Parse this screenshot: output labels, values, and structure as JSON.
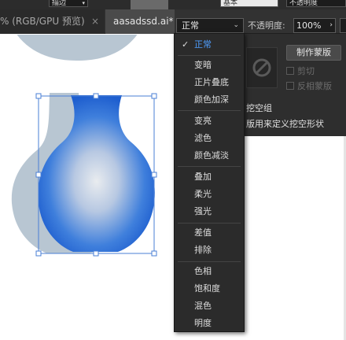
{
  "top_bar": {
    "chip_left_label": "描边",
    "chip_mid_label": "基本",
    "chip_right_label": "不透明度"
  },
  "tabs": [
    {
      "label": "% (RGB/GPU 预览)",
      "close": "×"
    },
    {
      "label": "aasadssd.ai*"
    }
  ],
  "blend_mode": {
    "current": "正常",
    "arrow": "⌄"
  },
  "opacity": {
    "label": "不透明度:",
    "value": "100%",
    "arrow": "›"
  },
  "menu": {
    "items": [
      {
        "label": "正常",
        "checked": true
      },
      {
        "label": "变暗"
      },
      {
        "label": "正片叠底"
      },
      {
        "label": "颜色加深"
      },
      {
        "label": "变亮"
      },
      {
        "label": "滤色"
      },
      {
        "label": "颜色减淡"
      },
      {
        "label": "叠加"
      },
      {
        "label": "柔光"
      },
      {
        "label": "强光"
      },
      {
        "label": "差值"
      },
      {
        "label": "排除"
      },
      {
        "label": "色相"
      },
      {
        "label": "饱和度"
      },
      {
        "label": "混色"
      },
      {
        "label": "明度"
      }
    ],
    "check_glyph": "✓"
  },
  "transparency_panel": {
    "make_mask_button": "制作蒙版",
    "clip_label": "剪切",
    "invert_mask_label": "反相蒙版",
    "knockout_group_label": "挖空组",
    "opacity_knockout_label": "版用来定义挖空形状"
  },
  "colors": {
    "vase_blue": "#2f6fd6",
    "vase_shadow": "#b8c6d2",
    "check_accent": "#4f9fff",
    "ui_dark": "#2b2b2b"
  }
}
